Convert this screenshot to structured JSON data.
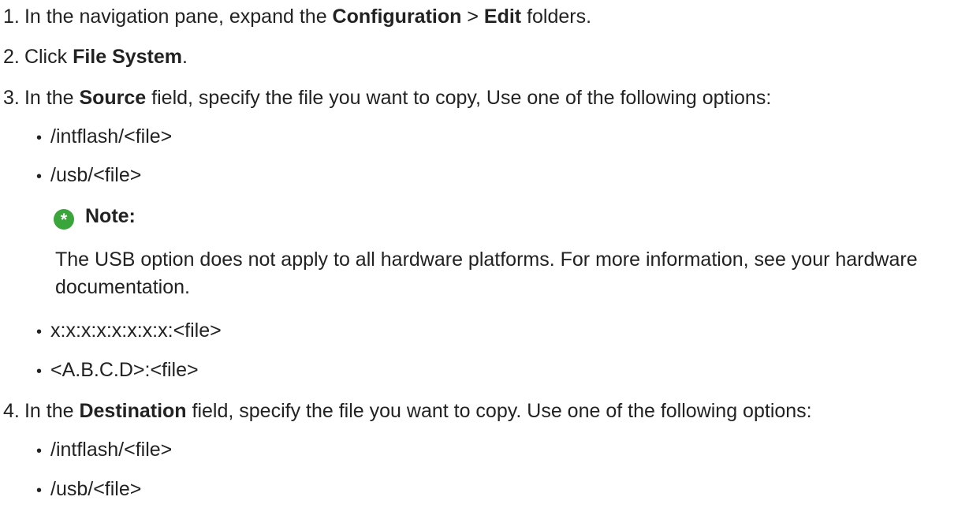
{
  "steps": [
    {
      "number": "1.",
      "before": "In the navigation pane, expand the ",
      "bold1": "Configuration",
      "middle": " > ",
      "bold2": "Edit",
      "after": " folders."
    },
    {
      "number": "2.",
      "before": "Click ",
      "bold1": "File System",
      "after": "."
    },
    {
      "number": "3.",
      "before": "In the ",
      "bold1": "Source",
      "after": " field, specify the file you want to copy, Use one of the following options:",
      "options": [
        "/intflash/<file>",
        "/usb/<file>",
        "x:x:x:x:x:x:x:x:<file>",
        "<A.B.C.D>:<file>"
      ],
      "note": {
        "label": "Note:",
        "text": "The USB option does not apply to all hardware platforms. For more information, see your hardware documentation."
      }
    },
    {
      "number": "4.",
      "before": "In the ",
      "bold1": "Destination",
      "after": " field, specify the file you want to copy. Use one of the following options:",
      "options": [
        "/intflash/<file>",
        "/usb/<file>"
      ]
    }
  ],
  "bullet_char": "•",
  "note_icon_char": "*",
  "colors": {
    "text": "#222222",
    "note_icon": "#3aa53a"
  }
}
